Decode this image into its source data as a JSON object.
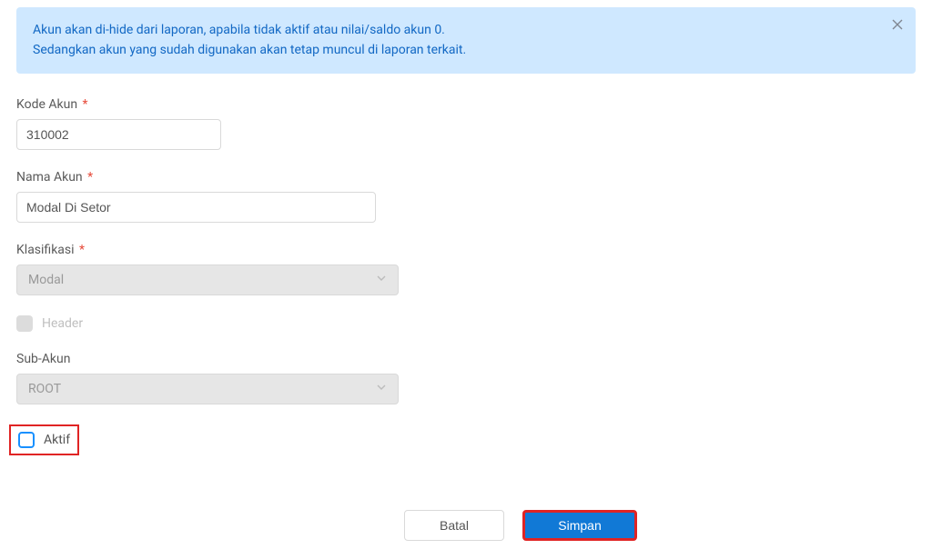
{
  "alert": {
    "line1": "Akun akan di-hide dari laporan, apabila tidak aktif atau nilai/saldo akun 0.",
    "line2": "Sedangkan akun yang sudah digunakan akan tetap muncul di laporan terkait."
  },
  "fields": {
    "kode_akun": {
      "label": "Kode Akun",
      "value": "310002",
      "required": true
    },
    "nama_akun": {
      "label": "Nama Akun",
      "value": "Modal Di Setor",
      "required": true
    },
    "klasifikasi": {
      "label": "Klasifikasi",
      "value": "Modal",
      "required": true
    },
    "header": {
      "label": "Header",
      "checked": false,
      "disabled": true
    },
    "sub_akun": {
      "label": "Sub-Akun",
      "value": "ROOT",
      "required": false
    },
    "aktif": {
      "label": "Aktif",
      "checked": false
    }
  },
  "buttons": {
    "cancel": "Batal",
    "save": "Simpan"
  },
  "required_marker": "*"
}
